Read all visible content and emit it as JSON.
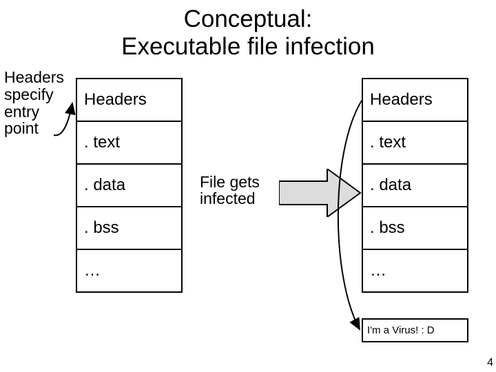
{
  "title_line1": "Conceptual:",
  "title_line2": "Executable file infection",
  "annotation": "Headers specify entry point",
  "left": {
    "s0": "Headers",
    "s1": ". text",
    "s2": ". data",
    "s3": ". bss",
    "s4": "…"
  },
  "right": {
    "s0": "Headers",
    "s1": ". text",
    "s2": ". data",
    "s3": ". bss",
    "s4": "…"
  },
  "virus": "I'm a Virus! : D",
  "arrow_label": "File gets infected",
  "pagenum": "4"
}
